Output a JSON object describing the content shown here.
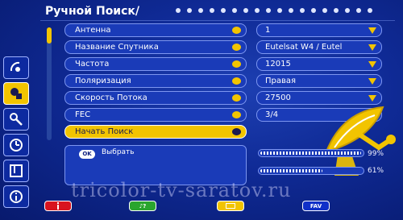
{
  "header": {
    "title": "Ручной Поиск/"
  },
  "settings": [
    {
      "label": "Антенна",
      "value": "1"
    },
    {
      "label": "Название Спутника",
      "value": "Eutelsat W4 / Eutel"
    },
    {
      "label": "Частота",
      "value": "12015"
    },
    {
      "label": "Поляризация",
      "value": "Правая"
    },
    {
      "label": "Скорость Потока",
      "value": "27500"
    },
    {
      "label": "FEC",
      "value": "3/4"
    }
  ],
  "action": {
    "label": "Начать Поиск"
  },
  "info": {
    "ok_key": "OK",
    "ok_label": "Выбрать"
  },
  "signal": {
    "strength": "99%",
    "quality": "61%",
    "strength_level": 0.99,
    "quality_level": 0.61
  },
  "watermark": "tricolor-tv-saratov.ru",
  "bottom_keys": {
    "green_label": "♪?",
    "blue_label": "FAV"
  },
  "sidebar": [
    "satellite-icon",
    "channel-icon",
    "tools-icon",
    "timer-icon",
    "layout-icon",
    "info-icon"
  ],
  "colors": {
    "accent": "#f2c400",
    "background": "#0f2a95",
    "red": "#d8141f",
    "green": "#2aa52e",
    "blue": "#1030c8"
  }
}
